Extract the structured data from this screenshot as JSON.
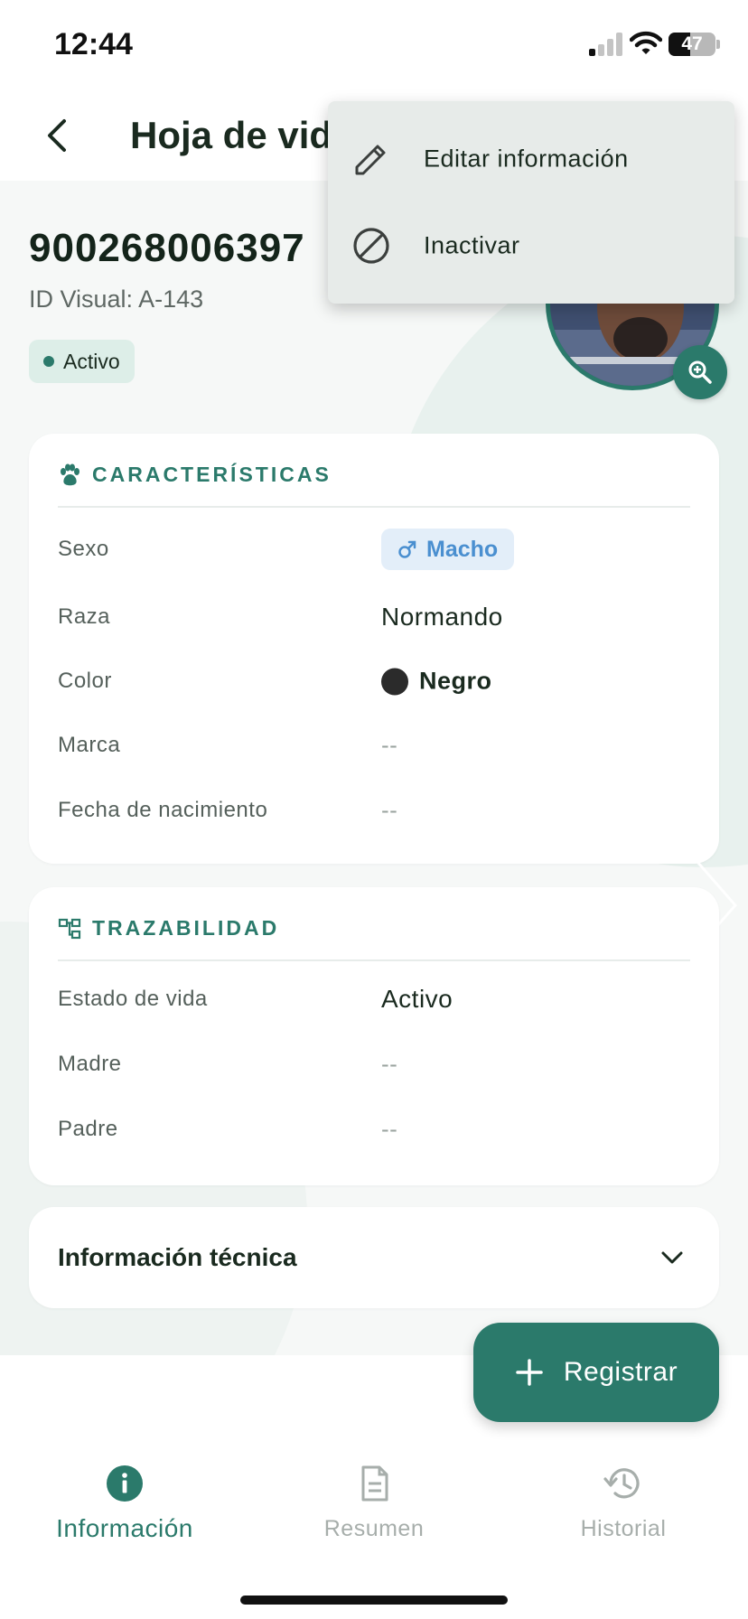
{
  "status_bar": {
    "time": "12:44",
    "battery": "47",
    "battery_level": 0.47
  },
  "header": {
    "title": "Hoja de vida"
  },
  "animal": {
    "id": "900268006397",
    "visual_id": "ID Visual: A-143",
    "status": "Activo"
  },
  "menu": {
    "items": [
      {
        "label": "Editar información",
        "icon": "pencil-icon"
      },
      {
        "label": "Inactivar",
        "icon": "block-icon"
      }
    ]
  },
  "characteristics": {
    "title": "CARACTERÍSTICAS",
    "rows": [
      {
        "label": "Sexo",
        "value": "Macho"
      },
      {
        "label": "Raza",
        "value": "Normando"
      },
      {
        "label": "Color",
        "value": "Negro"
      },
      {
        "label": "Marca",
        "value": "--"
      },
      {
        "label": "Fecha de nacimiento",
        "value": "--"
      }
    ]
  },
  "traceability": {
    "title": "TRAZABILIDAD",
    "rows": [
      {
        "label": "Estado de vida",
        "value": "Activo"
      },
      {
        "label": "Madre",
        "value": "--"
      },
      {
        "label": "Padre",
        "value": "--"
      }
    ]
  },
  "technical": {
    "title": "Información técnica"
  },
  "fab": {
    "label": "Registrar"
  },
  "bottom_nav": {
    "items": [
      {
        "label": "Información",
        "icon": "info-icon",
        "active": true
      },
      {
        "label": "Resumen",
        "icon": "document-icon",
        "active": false
      },
      {
        "label": "Historial",
        "icon": "history-icon",
        "active": false
      }
    ]
  },
  "colors": {
    "primary": "#2b7a6b",
    "male_chip_text": "#4a8fd0",
    "male_chip_bg": "#e3eef9",
    "inactive_nav": "#a7aeab"
  }
}
